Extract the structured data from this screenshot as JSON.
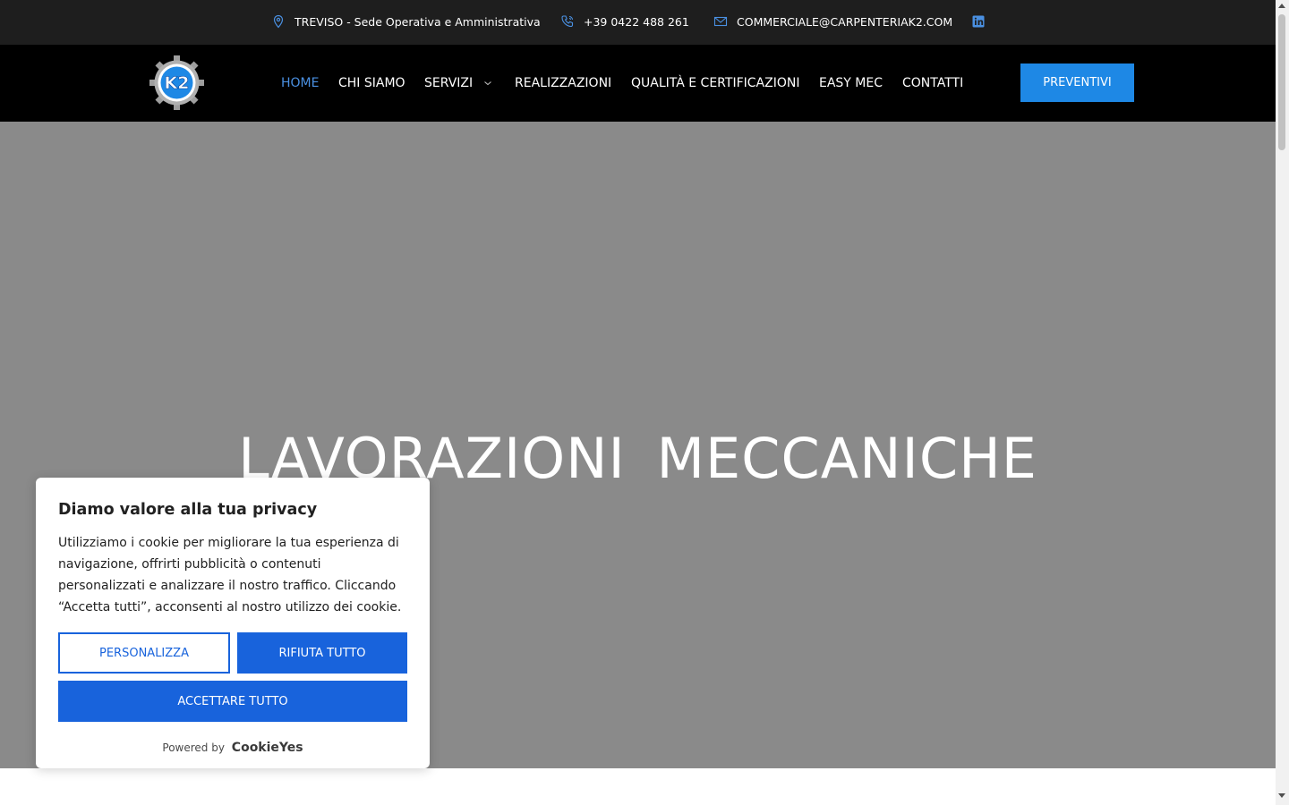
{
  "topbar": {
    "location": "TREVISO - Sede Operativa e Amministrativa",
    "phone": "+39 0422 488 261",
    "email": "COMMERCIALE@CARPENTERIAK2.COM",
    "location_icon": "map-pin-icon",
    "phone_icon": "phone-icon",
    "email_icon": "mail-icon",
    "social_icon": "linkedin-icon"
  },
  "logo": {
    "text": "K2"
  },
  "nav": {
    "items": [
      {
        "label": "HOME",
        "active": true
      },
      {
        "label": "CHI SIAMO"
      },
      {
        "label": "SERVIZI",
        "has_dropdown": true
      },
      {
        "label": "REALIZZAZIONI"
      },
      {
        "label": "QUALITÀ E CERTIFICAZIONI"
      },
      {
        "label": "EASY MEC"
      },
      {
        "label": "CONTATTI"
      }
    ],
    "cta": "PREVENTIVI"
  },
  "hero": {
    "title": "LAVORAZIONI  MECCANICHE"
  },
  "cookie": {
    "title": "Diamo valore alla tua privacy",
    "text": "Utilizziamo i cookie per migliorare la tua esperienza di navigazione, offrirti pubblicità o contenuti personalizzati e analizzare il nostro traffico. Cliccando “Accetta tutti”, acconsenti al nostro utilizzo dei cookie.",
    "customize": "PERSONALIZZA",
    "reject": "RIFIUTA TUTTO",
    "accept": "ACCETTARE TUTTO",
    "powered_prefix": "Powered by",
    "powered_brand": "CookieYes"
  },
  "colors": {
    "accent": "#1e88e5",
    "active_link": "#4a90e2",
    "cookie_button": "#1863dc",
    "topbar_bg": "#1e1e1e",
    "nav_bg": "#000000",
    "hero_bg": "#8a8a8a"
  }
}
